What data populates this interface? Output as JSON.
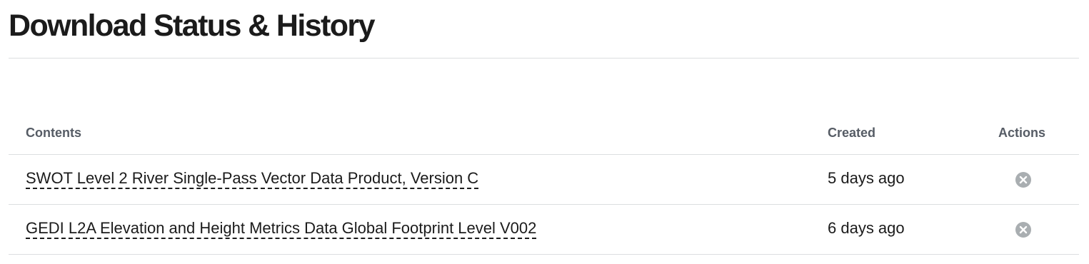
{
  "page": {
    "title": "Download Status & History"
  },
  "table": {
    "headers": {
      "contents": "Contents",
      "created": "Created",
      "actions": "Actions"
    },
    "rows": [
      {
        "contents": "SWOT Level 2 River Single-Pass Vector Data Product, Version C",
        "created": "5 days ago",
        "action_icon": "close-circle-icon"
      },
      {
        "contents": "GEDI L2A Elevation and Height Metrics Data Global Footprint Level V002",
        "created": "6 days ago",
        "action_icon": "close-circle-icon"
      }
    ]
  },
  "colors": {
    "text": "#1b1b1b",
    "header_text": "#565c65",
    "divider": "#dcdee0",
    "action_icon": "#a9aeb1"
  }
}
